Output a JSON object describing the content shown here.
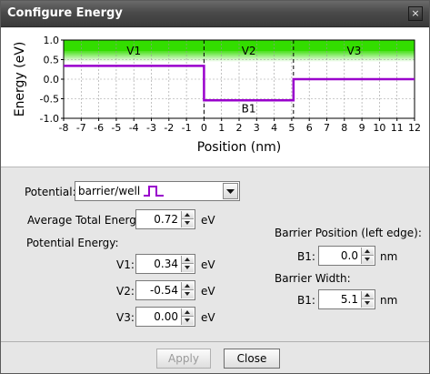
{
  "window": {
    "title": "Configure Energy",
    "close_glyph": "×"
  },
  "chart_data": {
    "type": "line",
    "xlabel": "Position (nm)",
    "ylabel": "Energy (eV)",
    "xlim": [
      -8,
      12
    ],
    "ylim": [
      -1.0,
      1.0
    ],
    "x_ticks": [
      "-8",
      "-7",
      "-6",
      "-5",
      "-4",
      "-3",
      "-2",
      "-1",
      "0",
      "1",
      "2",
      "3",
      "4",
      "5",
      "6",
      "7",
      "8",
      "9",
      "10",
      "11",
      "12"
    ],
    "y_ticks": [
      "1.0",
      "0.5",
      "0.0",
      "-0.5",
      "-1.0"
    ],
    "grid": true,
    "total_energy_band": {
      "value": 0.72,
      "color": "#33dd00"
    },
    "series": [
      {
        "values": [
          {
            "x": -8,
            "y": 0.34
          },
          {
            "x": 0,
            "y": 0.34
          },
          {
            "x": 0,
            "y": -0.54
          },
          {
            "x": 5.1,
            "y": -0.54
          },
          {
            "x": 5.1,
            "y": 0.0
          },
          {
            "x": 12,
            "y": 0.0
          }
        ],
        "color": "#9900cc"
      }
    ],
    "region_boundaries": [
      0,
      5.1
    ],
    "region_labels": [
      {
        "text": "V1",
        "x": -4,
        "y": 0.72
      },
      {
        "text": "V2",
        "x": 2.55,
        "y": 0.72
      },
      {
        "text": "V3",
        "x": 8.55,
        "y": 0.72
      },
      {
        "text": "B1",
        "x": 2.55,
        "y": -0.75
      }
    ]
  },
  "potential": {
    "label": "Potential:",
    "selected": "barrier/well",
    "icon": "barrier-well-pulse-icon"
  },
  "average_total_energy": {
    "label": "Average Total Energy:",
    "value": "0.72",
    "unit": "eV"
  },
  "potential_energy": {
    "heading": "Potential Energy:",
    "rows": [
      {
        "label": "V1:",
        "value": "0.34",
        "unit": "eV"
      },
      {
        "label": "V2:",
        "value": "-0.54",
        "unit": "eV"
      },
      {
        "label": "V3:",
        "value": "0.00",
        "unit": "eV"
      }
    ]
  },
  "barrier_position": {
    "heading": "Barrier Position (left edge):",
    "label": "B1:",
    "value": "0.0",
    "unit": "nm"
  },
  "barrier_width": {
    "heading": "Barrier Width:",
    "label": "B1:",
    "value": "5.1",
    "unit": "nm"
  },
  "buttons": {
    "apply": "Apply",
    "close": "Close"
  }
}
